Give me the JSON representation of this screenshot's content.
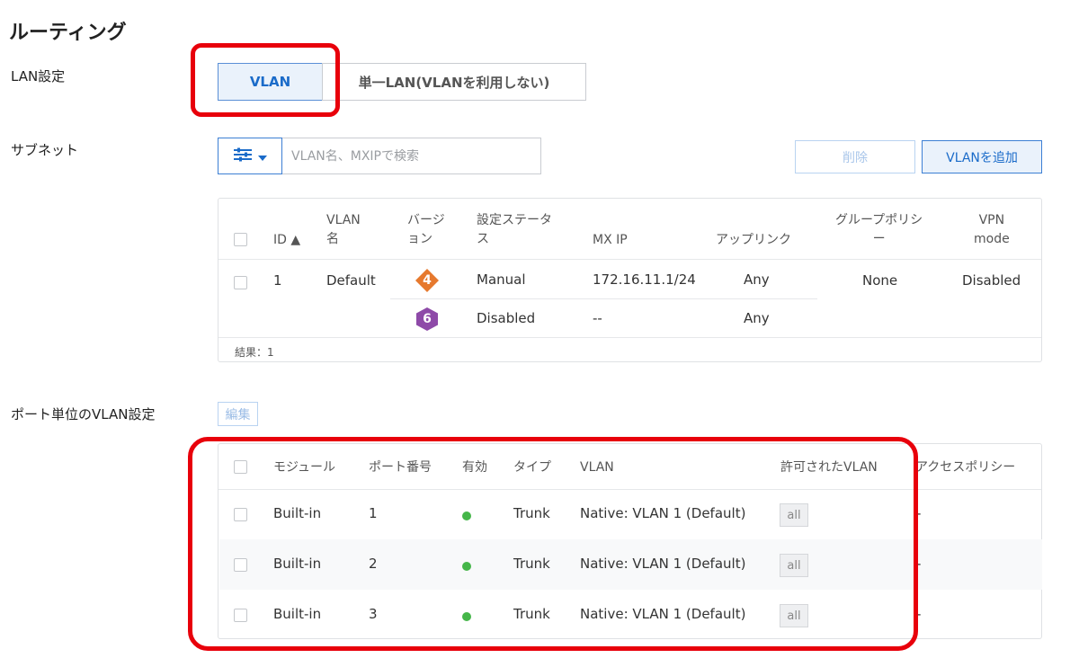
{
  "page": {
    "title": "ルーティング"
  },
  "lan": {
    "label": "LAN設定",
    "options": [
      "VLAN",
      "単一LAN(VLANを利用しない)"
    ],
    "selected": "VLAN"
  },
  "subnet": {
    "label": "サブネット",
    "search_placeholder": "VLAN名、MXIPで検索",
    "delete_label": "削除",
    "add_label": "VLANを追加",
    "columns": {
      "id": "ID ▲",
      "vlan_name": "VLAN\n名",
      "version": "バージ\nョン",
      "config_status": "設定ステータ\nス",
      "mx_ip": "MX IP",
      "uplink": "アップリンク",
      "group_policy": "グループポリシ\nー",
      "vpn_mode": "VPN\nmode"
    },
    "rows": [
      {
        "id": "1",
        "name": "Default",
        "v4_badge": "4",
        "v4_status": "Manual",
        "v4_mx_ip": "172.16.11.1/24",
        "v4_uplink": "Any",
        "v6_badge": "6",
        "v6_status": "Disabled",
        "v6_mx_ip": "--",
        "v6_uplink": "Any",
        "group_policy": "None",
        "vpn_mode": "Disabled"
      }
    ],
    "result": "結果：1",
    "colors": {
      "ipv4_badge": "#e6792e",
      "ipv6_badge": "#8e4aa8"
    }
  },
  "ports": {
    "label": "ポート単位のVLAN設定",
    "edit_label": "編集",
    "columns": {
      "module": "モジュール",
      "port": "ポート番号",
      "enabled": "有効",
      "type": "タイプ",
      "vlan": "VLAN",
      "allowed": "許可されたVLAN",
      "access_policy": "アクセスポリシー"
    },
    "rows": [
      {
        "module": "Built-in",
        "port": "1",
        "enabled": true,
        "type": "Trunk",
        "vlan": "Native: VLAN 1 (Default)",
        "allowed": "all",
        "access_policy": "-"
      },
      {
        "module": "Built-in",
        "port": "2",
        "enabled": true,
        "type": "Trunk",
        "vlan": "Native: VLAN 1 (Default)",
        "allowed": "all",
        "access_policy": "-"
      },
      {
        "module": "Built-in",
        "port": "3",
        "enabled": true,
        "type": "Trunk",
        "vlan": "Native: VLAN 1 (Default)",
        "allowed": "all",
        "access_policy": "-"
      }
    ]
  },
  "annotations": {
    "highlight_color": "#e8000b"
  }
}
